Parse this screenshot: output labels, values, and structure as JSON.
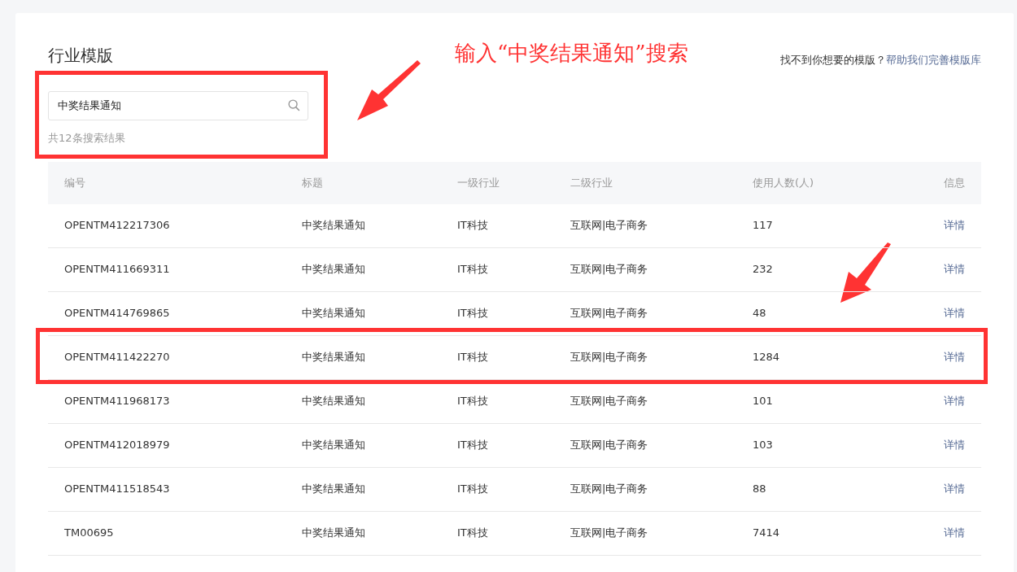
{
  "page": {
    "title": "行业模版",
    "annotation": "输入“中奖结果通知”搜索",
    "help_text": "找不到你想要的模版？",
    "help_link": "帮助我们完善模版库"
  },
  "search": {
    "value": "中奖结果通知",
    "result_count": "共12条搜索结果",
    "highlighted": true
  },
  "table": {
    "columns": [
      "编号",
      "标题",
      "一级行业",
      "二级行业",
      "使用人数(人)",
      "信息"
    ],
    "rows": [
      {
        "id": "OPENTM412217306",
        "title": "中奖结果通知",
        "industry_1": "IT科技",
        "industry_2": "互联网|电子商务",
        "users": "117",
        "info": "详情",
        "highlighted": false
      },
      {
        "id": "OPENTM411669311",
        "title": "中奖结果通知",
        "industry_1": "IT科技",
        "industry_2": "互联网|电子商务",
        "users": "232",
        "info": "详情",
        "highlighted": false
      },
      {
        "id": "OPENTM414769865",
        "title": "中奖结果通知",
        "industry_1": "IT科技",
        "industry_2": "互联网|电子商务",
        "users": "48",
        "info": "详情",
        "highlighted": false
      },
      {
        "id": "OPENTM411422270",
        "title": "中奖结果通知",
        "industry_1": "IT科技",
        "industry_2": "互联网|电子商务",
        "users": "1284",
        "info": "详情",
        "highlighted": true
      },
      {
        "id": "OPENTM411968173",
        "title": "中奖结果通知",
        "industry_1": "IT科技",
        "industry_2": "互联网|电子商务",
        "users": "101",
        "info": "详情",
        "highlighted": false
      },
      {
        "id": "OPENTM412018979",
        "title": "中奖结果通知",
        "industry_1": "IT科技",
        "industry_2": "互联网|电子商务",
        "users": "103",
        "info": "详情",
        "highlighted": false
      },
      {
        "id": "OPENTM411518543",
        "title": "中奖结果通知",
        "industry_1": "IT科技",
        "industry_2": "互联网|电子商务",
        "users": "88",
        "info": "详情",
        "highlighted": false
      },
      {
        "id": "TM00695",
        "title": "中奖结果通知",
        "industry_1": "IT科技",
        "industry_2": "互联网|电子商务",
        "users": "7414",
        "info": "详情",
        "highlighted": false
      }
    ]
  }
}
